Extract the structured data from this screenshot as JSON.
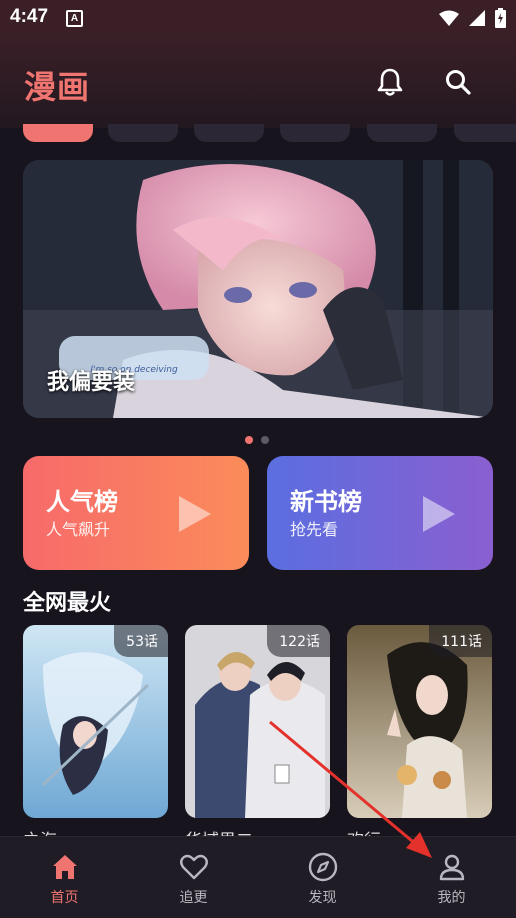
{
  "status": {
    "time": "4:47",
    "a_label": "A"
  },
  "header": {
    "title": "漫画",
    "bell_icon": "bell-icon",
    "search_icon": "search-icon"
  },
  "banner": {
    "title": "我偏要装",
    "logo_text": "I'm so on deceiving"
  },
  "carousel": {
    "active_index": 0,
    "count": 2
  },
  "ranks": [
    {
      "title": "人气榜",
      "subtitle": "人气飙升"
    },
    {
      "title": "新书榜",
      "subtitle": "抢先看"
    }
  ],
  "section": {
    "title": "全网最火"
  },
  "comics": [
    {
      "badge": "53话",
      "name": "之海"
    },
    {
      "badge": "122话",
      "name": "华域男二"
    },
    {
      "badge": "111话",
      "name": "欢行"
    }
  ],
  "nav": [
    {
      "label": "首页",
      "icon": "home-icon",
      "active": true
    },
    {
      "label": "追更",
      "icon": "heart-icon",
      "active": false
    },
    {
      "label": "发现",
      "icon": "compass-icon",
      "active": false
    },
    {
      "label": "我的",
      "icon": "user-icon",
      "active": false
    }
  ],
  "colors": {
    "accent": "#f07570",
    "background": "#17141e"
  }
}
